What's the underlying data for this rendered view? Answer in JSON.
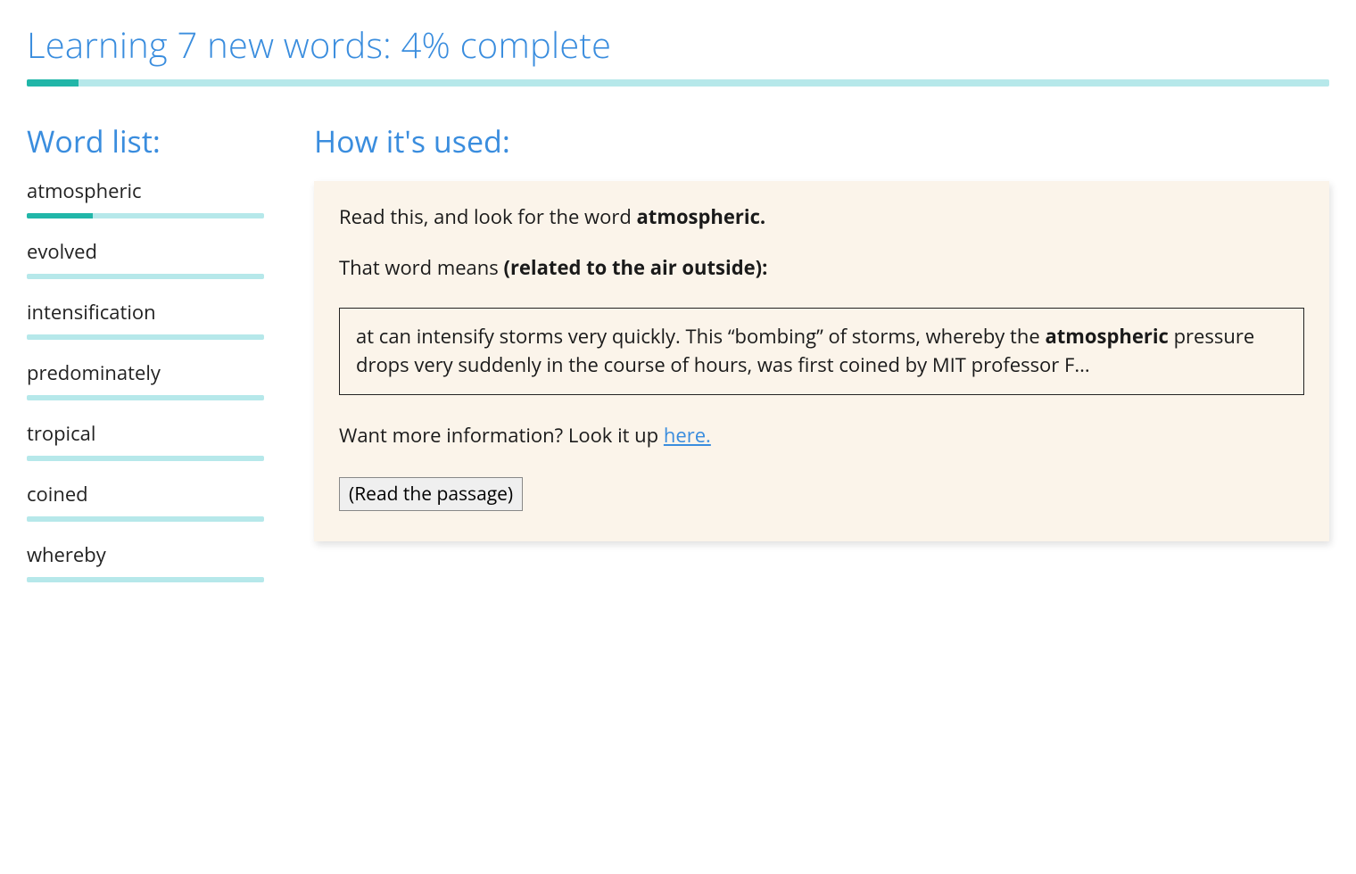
{
  "title": "Learning 7 new words: 4% complete",
  "progress_percent": 4,
  "sidebar": {
    "heading": "Word list:",
    "words": [
      {
        "label": "atmospheric",
        "progress": 28
      },
      {
        "label": "evolved",
        "progress": 0
      },
      {
        "label": "intensification",
        "progress": 0
      },
      {
        "label": "predominately",
        "progress": 0
      },
      {
        "label": "tropical",
        "progress": 0
      },
      {
        "label": "coined",
        "progress": 0
      },
      {
        "label": "whereby",
        "progress": 0
      }
    ]
  },
  "main": {
    "heading": "How it's used:",
    "lead_prefix": "Read this, and look for the word ",
    "lead_word": "atmospheric.",
    "means_prefix": "That word means ",
    "means_definition": "(related to the air outside):",
    "excerpt_before": "at can intensify storms very quickly. This “bombing” of storms, whereby the ",
    "excerpt_bold": "atmospheric",
    "excerpt_after": " pressure drops very suddenly in the course of hours, was first coined by MIT professor F...",
    "more_prefix": "Want more information? Look it up ",
    "more_link": "here.",
    "read_button": "(Read the passage)"
  }
}
